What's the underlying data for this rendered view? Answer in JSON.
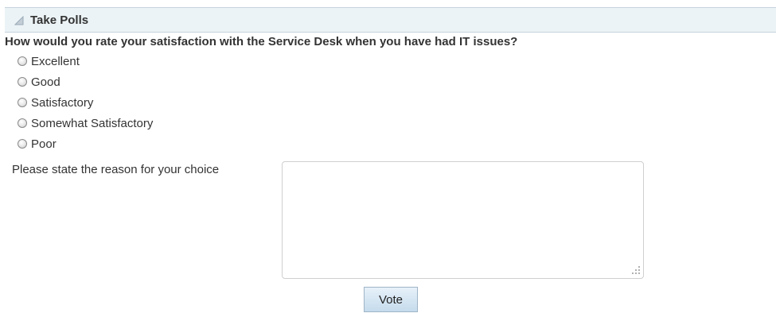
{
  "panel": {
    "title": "Take Polls"
  },
  "poll": {
    "question": "How would you rate your satisfaction with the Service Desk when you have had IT issues?",
    "options": [
      "Excellent",
      "Good",
      "Satisfactory",
      "Somewhat Satisfactory",
      "Poor"
    ],
    "selected_option": null,
    "reason_label": "Please state the reason for your choice",
    "reason_value": "",
    "vote_label": "Vote"
  },
  "icons": {
    "collapse": "collapse-triangle-icon",
    "radio": "radio-unchecked-icon",
    "resize": "resize-grip-icon"
  },
  "colors": {
    "header_background": "#ecf3f6",
    "header_border": "#c6d3dc",
    "button_top": "#e7f1f9",
    "button_bottom": "#c5dbec",
    "button_border": "#9fb5c7"
  }
}
